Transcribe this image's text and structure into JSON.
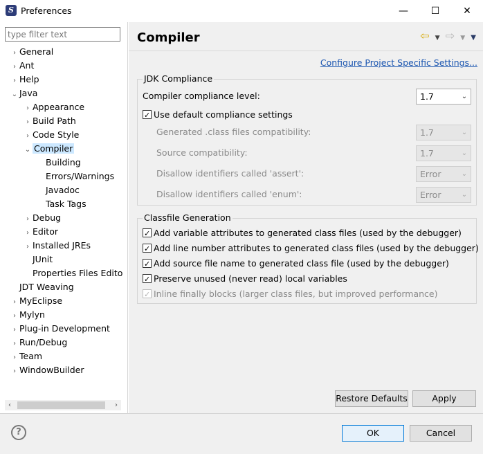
{
  "window": {
    "title": "Preferences",
    "minimize": "—",
    "maximize": "☐",
    "close": "✕"
  },
  "filter": {
    "placeholder": "type filter text"
  },
  "tree": [
    {
      "label": "General",
      "level": 0,
      "arrow": "›"
    },
    {
      "label": "Ant",
      "level": 0,
      "arrow": "›"
    },
    {
      "label": "Help",
      "level": 0,
      "arrow": "›"
    },
    {
      "label": "Java",
      "level": 0,
      "arrow": "⌄"
    },
    {
      "label": "Appearance",
      "level": 1,
      "arrow": "›"
    },
    {
      "label": "Build Path",
      "level": 1,
      "arrow": "›"
    },
    {
      "label": "Code Style",
      "level": 1,
      "arrow": "›"
    },
    {
      "label": "Compiler",
      "level": 1,
      "arrow": "⌄",
      "selected": true
    },
    {
      "label": "Building",
      "level": 2,
      "arrow": ""
    },
    {
      "label": "Errors/Warnings",
      "level": 2,
      "arrow": ""
    },
    {
      "label": "Javadoc",
      "level": 2,
      "arrow": ""
    },
    {
      "label": "Task Tags",
      "level": 2,
      "arrow": ""
    },
    {
      "label": "Debug",
      "level": 1,
      "arrow": "›"
    },
    {
      "label": "Editor",
      "level": 1,
      "arrow": "›"
    },
    {
      "label": "Installed JREs",
      "level": 1,
      "arrow": "›"
    },
    {
      "label": "JUnit",
      "level": 1,
      "arrow": ""
    },
    {
      "label": "Properties Files Edito",
      "level": 1,
      "arrow": ""
    },
    {
      "label": "JDT Weaving",
      "level": 0,
      "arrow": ""
    },
    {
      "label": "MyEclipse",
      "level": 0,
      "arrow": "›"
    },
    {
      "label": "Mylyn",
      "level": 0,
      "arrow": "›"
    },
    {
      "label": "Plug-in Development",
      "level": 0,
      "arrow": "›"
    },
    {
      "label": "Run/Debug",
      "level": 0,
      "arrow": "›"
    },
    {
      "label": "Team",
      "level": 0,
      "arrow": "›"
    },
    {
      "label": "WindowBuilder",
      "level": 0,
      "arrow": "›"
    }
  ],
  "page": {
    "title": "Compiler",
    "link": "Configure Project Specific Settings..."
  },
  "jdk": {
    "group_title": "JDK Compliance",
    "compliance_label": "Compiler compliance level:",
    "compliance_value": "1.7",
    "use_default_label": "Use default compliance settings",
    "generated_label": "Generated .class files compatibility:",
    "generated_value": "1.7",
    "source_label": "Source compatibility:",
    "source_value": "1.7",
    "assert_label": "Disallow identifiers called 'assert':",
    "assert_value": "Error",
    "enum_label": "Disallow identifiers called 'enum':",
    "enum_value": "Error"
  },
  "classfile": {
    "group_title": "Classfile Generation",
    "options": [
      "Add variable attributes to generated class files (used by the debugger)",
      "Add line number attributes to generated class files (used by the debugger)",
      "Add source file name to generated class file (used by the debugger)",
      "Preserve unused (never read) local variables",
      "Inline finally blocks (larger class files, but improved performance)"
    ]
  },
  "buttons": {
    "restore_defaults": "Restore Defaults",
    "apply": "Apply",
    "ok": "OK",
    "cancel": "Cancel",
    "help": "?"
  },
  "icons": {
    "chevron_collapsed": "›",
    "chevron_expanded": "⌄",
    "dropdown": "⌄",
    "back": "⇦",
    "forward": "⇨",
    "menu_down": "▼",
    "scroll_left": "‹",
    "scroll_right": "›",
    "app": "S"
  }
}
